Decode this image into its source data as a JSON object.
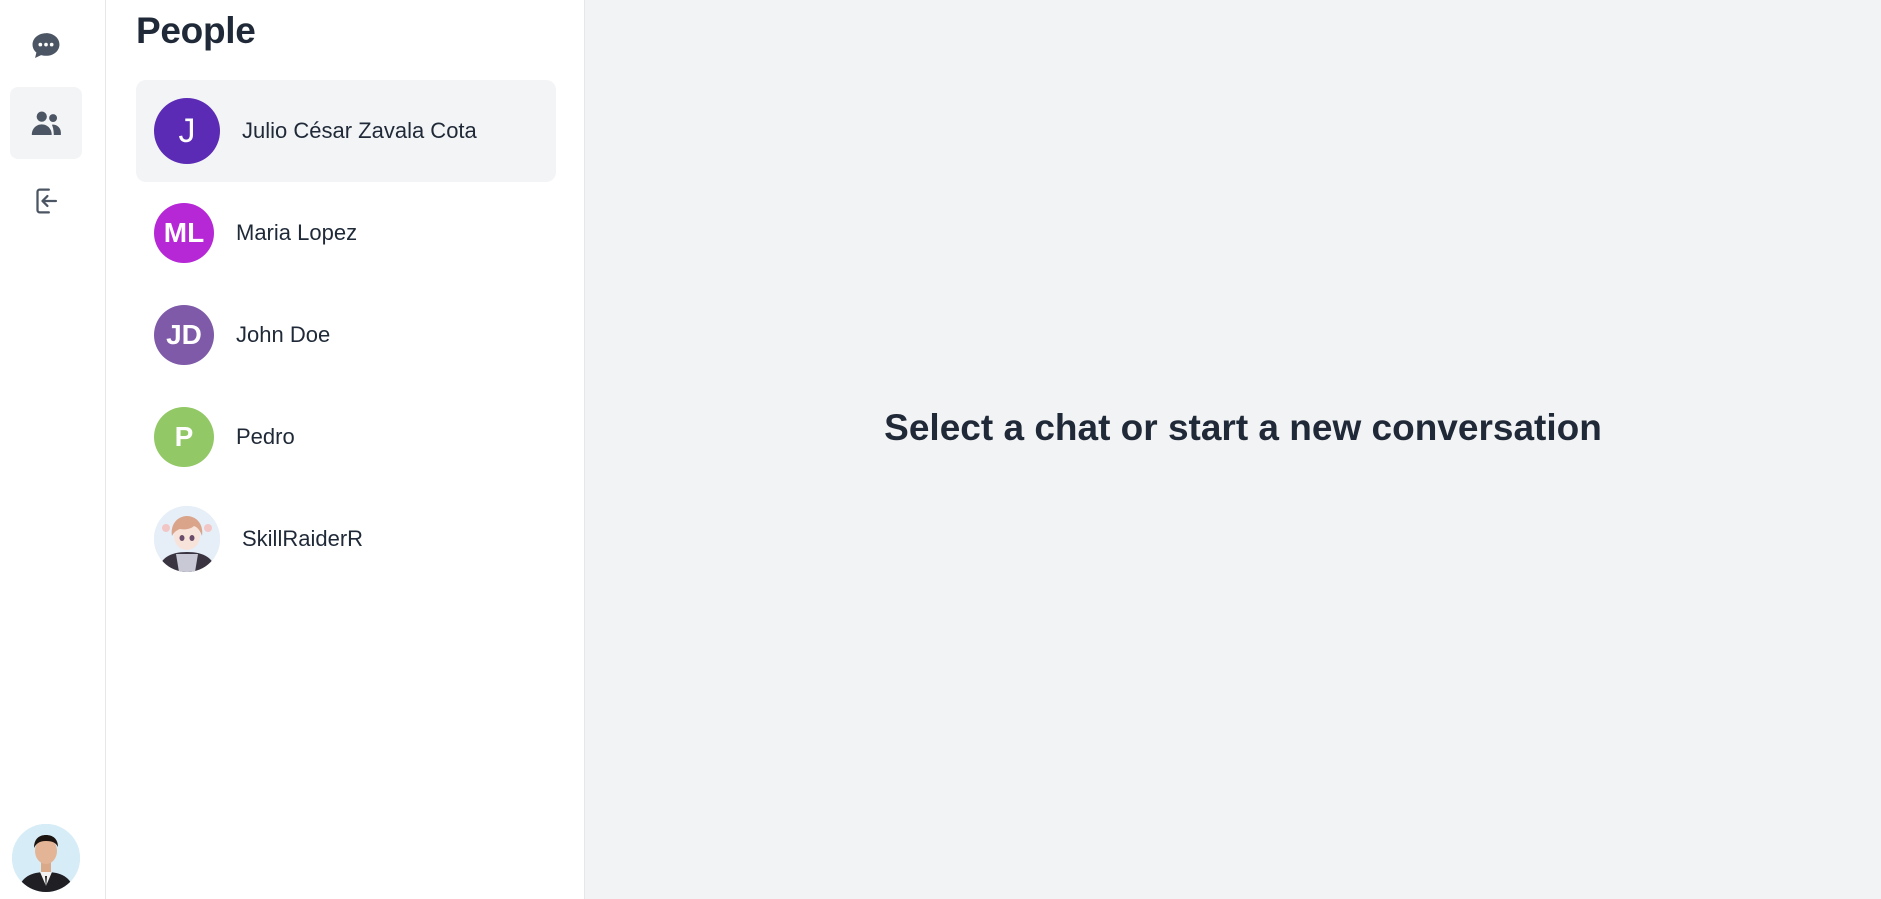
{
  "sidebar": {
    "items": [
      {
        "name": "chats",
        "icon": "chat-bubble-icon",
        "active": false
      },
      {
        "name": "people",
        "icon": "users-icon",
        "active": true
      },
      {
        "name": "logout",
        "icon": "logout-icon",
        "active": false
      }
    ],
    "user_avatar": "current-user-photo"
  },
  "people": {
    "title": "People",
    "list": [
      {
        "name": "Julio César Zavala Cota",
        "initials": "J",
        "color": "#5b2bb5",
        "selected": true
      },
      {
        "name": "Maria Lopez",
        "initials": "ML",
        "color": "#b627d6",
        "selected": false
      },
      {
        "name": "John Doe",
        "initials": "JD",
        "color": "#7e5aa8",
        "selected": false
      },
      {
        "name": "Pedro",
        "initials": "P",
        "color": "#92c865",
        "selected": false
      },
      {
        "name": "SkillRaiderR",
        "initials": "",
        "color": "#dbe9f5",
        "selected": false
      }
    ]
  },
  "main": {
    "empty_message": "Select a chat or start a new conversation"
  },
  "colors": {
    "rail_icon": "#4b5563",
    "active_bg": "#f3f4f6",
    "main_bg": "#f2f3f5"
  }
}
